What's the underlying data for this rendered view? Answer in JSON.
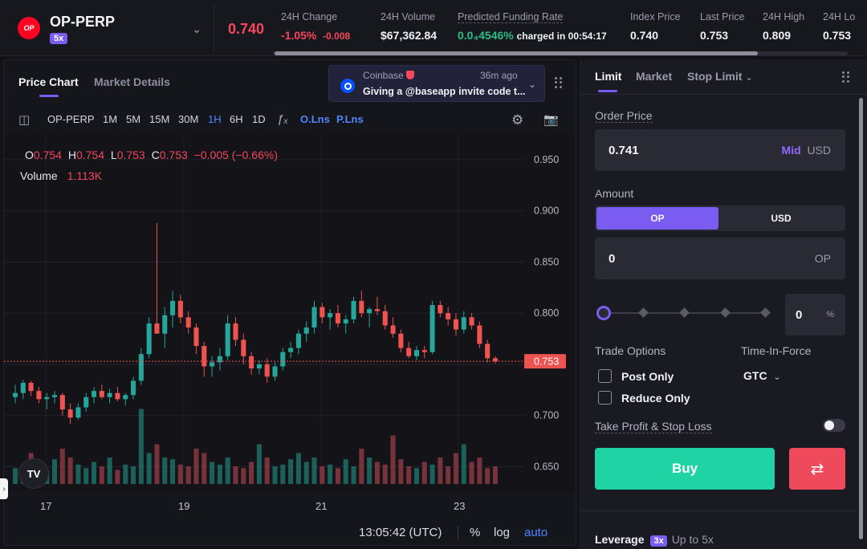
{
  "header": {
    "market_logo": "OP",
    "market": "OP-PERP",
    "leverage": "5x",
    "price": "0.740",
    "change_label": "24H Change",
    "change_pct": "-1.05%",
    "change_abs": "-0.008",
    "volume_label": "24H Volume",
    "volume": "$67,362.84",
    "funding_label": "Predicted Funding Rate",
    "funding_rate": "0.0₄4546%",
    "funding_charged": "charged in 00:54:17",
    "index_label": "Index Price",
    "index_price": "0.740",
    "last_label": "Last Price",
    "last_price": "0.753",
    "high_label": "24H High",
    "high_price": "0.809",
    "low_label": "24H Lo",
    "low_price": "0.753"
  },
  "left_tabs": {
    "price_chart": "Price Chart",
    "market_details": "Market Details"
  },
  "notification": {
    "source": "Coinbase",
    "time": "36m ago",
    "message": "Giving a @baseapp invite code t..."
  },
  "toolbar": {
    "symbol": "OP-PERP",
    "intervals": [
      "1M",
      "5M",
      "15M",
      "30M",
      "1H",
      "6H",
      "1D"
    ],
    "selected_interval": "1H",
    "indicator_icon": "ƒₓ",
    "o_lns": "O.Lns",
    "p_lns": "P.Lns"
  },
  "legend": {
    "o": "O",
    "o_val": "0.754",
    "h": "H",
    "h_val": "0.754",
    "l": "L",
    "l_val": "0.753",
    "c": "C",
    "c_val": "0.753",
    "change": "−0.005 (−0.66%)",
    "volume_label": "Volume",
    "volume_val": "1.113K"
  },
  "chart_data": {
    "type": "candlestick",
    "price_axis_ticks": [
      0.95,
      0.9,
      0.85,
      0.8,
      0.75,
      0.7,
      0.65
    ],
    "price_axis_labels": [
      "0.950",
      "0.900",
      "0.850",
      "0.800",
      "0.750",
      "0.700",
      "0.650"
    ],
    "ylim": [
      0.63,
      0.975
    ],
    "time_axis_labels": [
      "17",
      "19",
      "21",
      "23"
    ],
    "last_price_label": "0.753",
    "last_price": 0.753,
    "volume_label": "1.113K",
    "colors": {
      "up": "#26a69a",
      "down": "#ef5350"
    },
    "candles": [
      [
        0.718,
        0.73,
        0.712,
        0.722
      ],
      [
        0.722,
        0.735,
        0.716,
        0.732
      ],
      [
        0.732,
        0.734,
        0.719,
        0.724
      ],
      [
        0.724,
        0.728,
        0.712,
        0.716
      ],
      [
        0.716,
        0.722,
        0.706,
        0.718
      ],
      [
        0.718,
        0.724,
        0.712,
        0.72
      ],
      [
        0.72,
        0.722,
        0.7,
        0.706
      ],
      [
        0.706,
        0.712,
        0.692,
        0.698
      ],
      [
        0.698,
        0.712,
        0.696,
        0.708
      ],
      [
        0.708,
        0.722,
        0.704,
        0.718
      ],
      [
        0.718,
        0.728,
        0.712,
        0.724
      ],
      [
        0.724,
        0.73,
        0.716,
        0.718
      ],
      [
        0.718,
        0.726,
        0.712,
        0.722
      ],
      [
        0.722,
        0.728,
        0.714,
        0.716
      ],
      [
        0.716,
        0.722,
        0.71,
        0.72
      ],
      [
        0.72,
        0.738,
        0.716,
        0.734
      ],
      [
        0.734,
        0.766,
        0.73,
        0.76
      ],
      [
        0.76,
        0.796,
        0.756,
        0.79
      ],
      [
        0.79,
        0.888,
        0.784,
        0.78
      ],
      [
        0.78,
        0.806,
        0.766,
        0.798
      ],
      [
        0.798,
        0.822,
        0.786,
        0.812
      ],
      [
        0.812,
        0.818,
        0.79,
        0.796
      ],
      [
        0.796,
        0.802,
        0.78,
        0.786
      ],
      [
        0.786,
        0.79,
        0.76,
        0.768
      ],
      [
        0.768,
        0.772,
        0.738,
        0.748
      ],
      [
        0.748,
        0.758,
        0.738,
        0.752
      ],
      [
        0.752,
        0.766,
        0.744,
        0.758
      ],
      [
        0.758,
        0.798,
        0.754,
        0.79
      ],
      [
        0.79,
        0.796,
        0.768,
        0.774
      ],
      [
        0.774,
        0.78,
        0.75,
        0.758
      ],
      [
        0.758,
        0.762,
        0.74,
        0.746
      ],
      [
        0.746,
        0.754,
        0.74,
        0.75
      ],
      [
        0.75,
        0.756,
        0.732,
        0.738
      ],
      [
        0.738,
        0.752,
        0.734,
        0.748
      ],
      [
        0.748,
        0.766,
        0.744,
        0.762
      ],
      [
        0.762,
        0.772,
        0.756,
        0.766
      ],
      [
        0.766,
        0.784,
        0.76,
        0.78
      ],
      [
        0.78,
        0.792,
        0.772,
        0.786
      ],
      [
        0.786,
        0.812,
        0.78,
        0.806
      ],
      [
        0.806,
        0.81,
        0.79,
        0.796
      ],
      [
        0.796,
        0.804,
        0.784,
        0.8
      ],
      [
        0.8,
        0.808,
        0.786,
        0.79
      ],
      [
        0.79,
        0.798,
        0.78,
        0.794
      ],
      [
        0.794,
        0.816,
        0.79,
        0.812
      ],
      [
        0.812,
        0.822,
        0.796,
        0.8
      ],
      [
        0.8,
        0.806,
        0.786,
        0.804
      ],
      [
        0.804,
        0.816,
        0.798,
        0.802
      ],
      [
        0.802,
        0.808,
        0.784,
        0.788
      ],
      [
        0.788,
        0.796,
        0.776,
        0.78
      ],
      [
        0.78,
        0.784,
        0.762,
        0.766
      ],
      [
        0.766,
        0.772,
        0.756,
        0.758
      ],
      [
        0.758,
        0.768,
        0.754,
        0.764
      ],
      [
        0.764,
        0.768,
        0.756,
        0.762
      ],
      [
        0.762,
        0.812,
        0.76,
        0.808
      ],
      [
        0.808,
        0.812,
        0.796,
        0.8
      ],
      [
        0.8,
        0.806,
        0.788,
        0.794
      ],
      [
        0.794,
        0.8,
        0.778,
        0.784
      ],
      [
        0.784,
        0.802,
        0.78,
        0.796
      ],
      [
        0.796,
        0.8,
        0.784,
        0.788
      ],
      [
        0.788,
        0.792,
        0.766,
        0.77
      ],
      [
        0.77,
        0.774,
        0.752,
        0.756
      ],
      [
        0.756,
        0.758,
        0.751,
        0.753
      ]
    ],
    "volumes": [
      0.18,
      0.22,
      0.35,
      0.2,
      0.15,
      0.28,
      0.4,
      0.3,
      0.22,
      0.18,
      0.25,
      0.2,
      0.3,
      0.16,
      0.22,
      0.2,
      0.85,
      0.35,
      0.45,
      0.3,
      0.28,
      0.22,
      0.2,
      0.4,
      0.35,
      0.25,
      0.22,
      0.3,
      0.2,
      0.18,
      0.25,
      0.45,
      0.3,
      0.2,
      0.22,
      0.28,
      0.35,
      0.25,
      0.3,
      0.2,
      0.22,
      0.18,
      0.28,
      0.2,
      0.4,
      0.3,
      0.25,
      0.22,
      0.55,
      0.28,
      0.2,
      0.18,
      0.25,
      0.22,
      0.3,
      0.2,
      0.35,
      0.45,
      0.25,
      0.3,
      0.18,
      0.2
    ]
  },
  "bottom_bar": {
    "time": "13:05:42 (UTC)",
    "pct": "%",
    "log": "log",
    "auto": "auto"
  },
  "order": {
    "tabs": {
      "limit": "Limit",
      "market": "Market",
      "stop_limit": "Stop Limit"
    },
    "price_label": "Order Price",
    "price_value": "0.741",
    "price_mid": "Mid",
    "price_unit": "USD",
    "amount_label": "Amount",
    "amount_toggle": [
      "OP",
      "USD"
    ],
    "amount_value": "0",
    "amount_unit": "OP",
    "slider_percent": 0,
    "pct_value": "0",
    "pct_sign": "%",
    "trade_options_label": "Trade Options",
    "post_only": "Post Only",
    "reduce_only": "Reduce Only",
    "tif_label": "Time-In-Force",
    "tif_value": "GTC",
    "tpsl_label": "Take Profit & Stop Loss",
    "buy_label": "Buy",
    "leverage_label": "Leverage",
    "leverage_badge": "3x",
    "leverage_upto": "Up to 5x"
  }
}
